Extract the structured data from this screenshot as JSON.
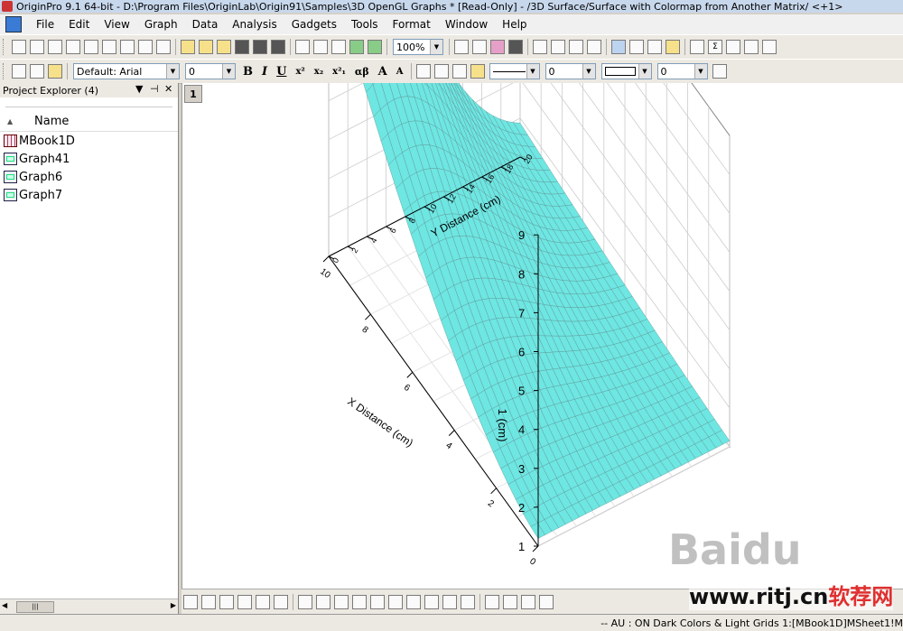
{
  "window": {
    "title": "OriginPro 9.1 64-bit - D:\\Program Files\\OriginLab\\Origin91\\Samples\\3D OpenGL Graphs * [Read-Only] - /3D Surface/Surface with Colormap from Another Matrix/ <+1>"
  },
  "menu": [
    "File",
    "Edit",
    "View",
    "Graph",
    "Data",
    "Analysis",
    "Gadgets",
    "Tools",
    "Format",
    "Window",
    "Help"
  ],
  "toolbar": {
    "zoom": "100%",
    "font": "Default: Arial",
    "font_size": "0",
    "bold": "B",
    "italic": "I",
    "underline": "U",
    "superscript": "x²",
    "subscript": "x₂",
    "superscript_sub": "x²₁",
    "greek": "αβ",
    "grow_font": "A",
    "shrink_font": "A",
    "line_width": "0",
    "pattern_value": "0"
  },
  "explorer": {
    "title": "Project Explorer (4)",
    "column": "Name",
    "items": [
      {
        "name": "MBook1D",
        "type": "book"
      },
      {
        "name": "Graph41",
        "type": "graph"
      },
      {
        "name": "Graph6",
        "type": "graph"
      },
      {
        "name": "Graph7",
        "type": "graph"
      }
    ]
  },
  "graph": {
    "layer_label": "1",
    "surface_color": "#6ee6e2",
    "mesh_color": "#5a8a8a"
  },
  "chart_data": {
    "type": "surface",
    "zlabel": "1 (cm)",
    "xlabel": "X Distance (cm)",
    "ylabel": "Y Distance (cm)",
    "z_ticks": [
      "1",
      "2",
      "3",
      "4",
      "5",
      "6",
      "7",
      "8",
      "9"
    ],
    "x_ticks": [
      "0",
      "2",
      "4",
      "6",
      "8",
      "10"
    ],
    "y_ticks": [
      "0",
      "2",
      "4",
      "6",
      "8",
      "10",
      "12",
      "14",
      "16",
      "18",
      "20"
    ],
    "zlim": [
      1,
      9
    ],
    "xlim": [
      0,
      10
    ],
    "ylim": [
      0,
      20
    ],
    "grid": true
  },
  "status": {
    "text": "--  AU : ON  Dark Colors & Light Grids  1:[MBook1D]MSheet1!M"
  },
  "watermark": {
    "site": "www.ritj.cn",
    "cn": "软荐网"
  }
}
